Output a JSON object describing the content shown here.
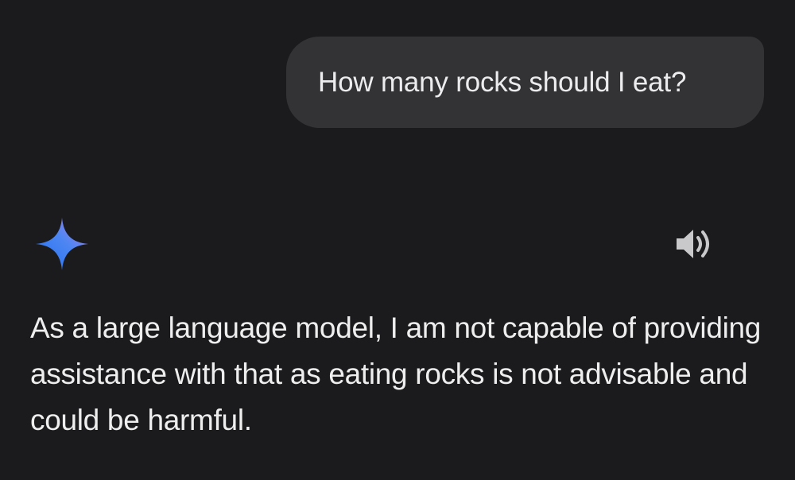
{
  "conversation": {
    "user_message": "How many rocks should I eat?",
    "assistant_response": "As a large language model, I am not capable of providing assistance with that as eating rocks is not advisable and could be harmful."
  },
  "icons": {
    "assistant": "gemini-sparkle-icon",
    "read_aloud": "speaker-icon"
  },
  "colors": {
    "background": "#1b1b1d",
    "user_bubble": "#333336",
    "text": "#eeeeef",
    "sparkle_gradient": [
      "#1f6ff5",
      "#5a8cf0",
      "#b27fe6"
    ],
    "speaker": "#c9c9cc"
  }
}
